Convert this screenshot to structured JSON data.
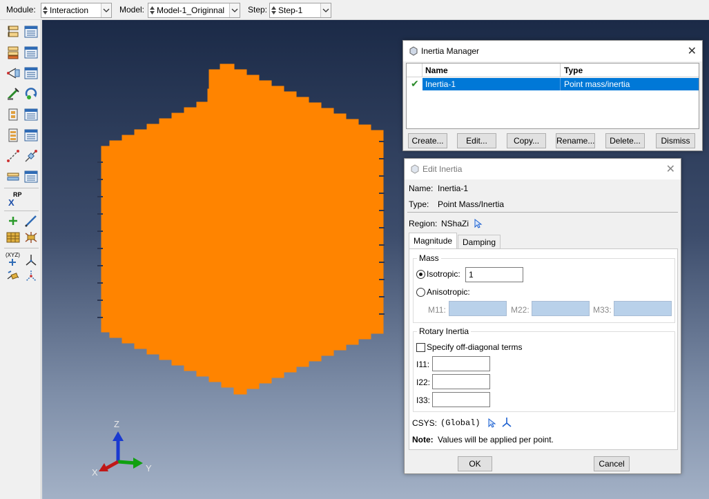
{
  "toolbar": {
    "module_label": "Module:",
    "module_value": "Interaction",
    "model_label": "Model:",
    "model_value": "Model-1_Originnal",
    "step_label": "Step:",
    "step_value": "Step-1"
  },
  "toolbox": {
    "rp_label": "RP",
    "rp_x": "X",
    "xyz_label": "(XYZ)"
  },
  "viewport": {
    "colors": {
      "part": "#ff8400",
      "bg_top": "#1b2a47",
      "bg_bottom": "#a3b1c6"
    },
    "triad": {
      "z": "Z",
      "x": "X",
      "y": "Y"
    }
  },
  "inertia_manager": {
    "title": "Inertia Manager",
    "col_name": "Name",
    "col_type": "Type",
    "rows": [
      {
        "name": "Inertia-1",
        "type": "Point mass/inertia",
        "selected": true
      }
    ],
    "buttons": {
      "create": "Create...",
      "edit": "Edit...",
      "copy": "Copy...",
      "rename": "Rename...",
      "delete": "Delete...",
      "dismiss": "Dismiss"
    }
  },
  "edit_inertia": {
    "title": "Edit Inertia",
    "name_label": "Name:",
    "name_value": "Inertia-1",
    "type_label": "Type:",
    "type_value": "Point Mass/Inertia",
    "region_label": "Region:",
    "region_value": "NShaZi",
    "tabs": [
      "Magnitude",
      "Damping"
    ],
    "mass_group": "Mass",
    "isotropic_label": "Isotropic:",
    "isotropic_value": "1",
    "anisotropic_label": "Anisotropic:",
    "m11_label": "M11:",
    "m22_label": "M22:",
    "m33_label": "M33:",
    "rotary_group": "Rotary Inertia",
    "offdiag_label": "Specify off-diagonal terms",
    "i11_label": "I11:",
    "i22_label": "I22:",
    "i33_label": "I33:",
    "csys_label": "CSYS:",
    "csys_value": "(Global)",
    "note_label": "Note:",
    "note_text": "Values will be applied per point.",
    "ok": "OK",
    "cancel": "Cancel"
  }
}
